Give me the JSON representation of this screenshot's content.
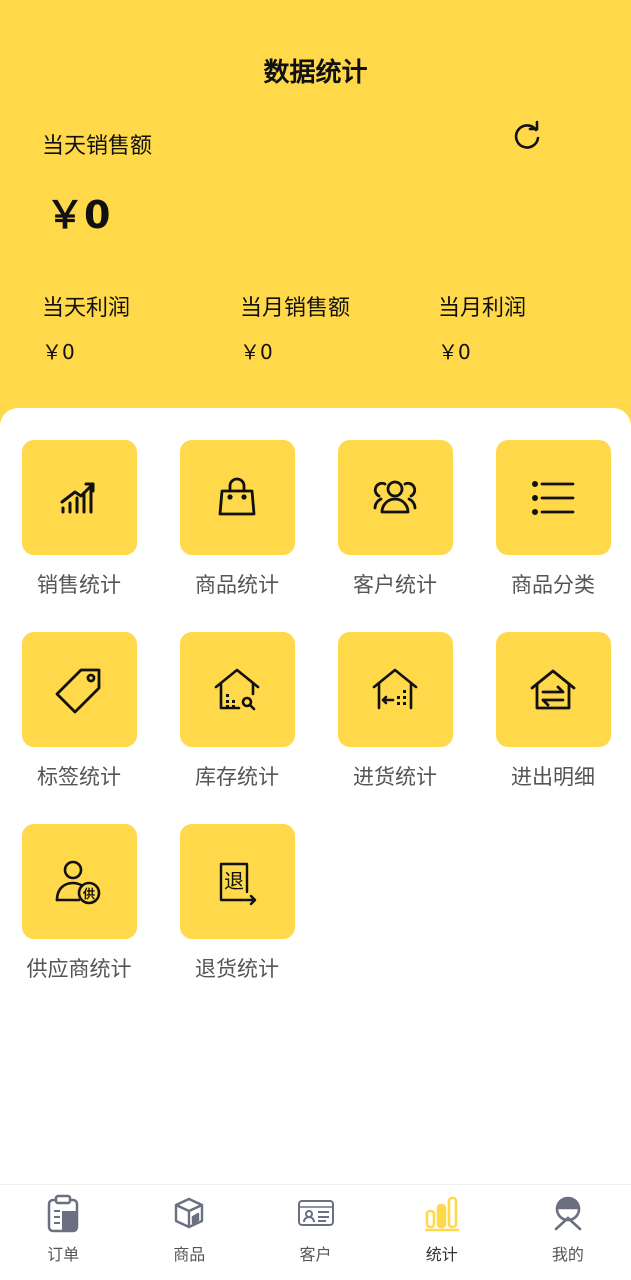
{
  "header": {
    "title": "数据统计",
    "today_sales_label": "当天销售额",
    "today_sales_value": "￥0",
    "stats": [
      {
        "label": "当天利润",
        "value": "￥0"
      },
      {
        "label": "当月销售额",
        "value": "￥0"
      },
      {
        "label": "当月利润",
        "value": "￥0"
      }
    ]
  },
  "grid": {
    "items": [
      {
        "label": "销售统计",
        "icon": "bar-chart-trend-icon"
      },
      {
        "label": "商品统计",
        "icon": "shopping-bag-icon"
      },
      {
        "label": "客户统计",
        "icon": "users-icon"
      },
      {
        "label": "商品分类",
        "icon": "list-icon"
      },
      {
        "label": "标签统计",
        "icon": "tag-icon"
      },
      {
        "label": "库存统计",
        "icon": "warehouse-search-icon"
      },
      {
        "label": "进货统计",
        "icon": "warehouse-inbound-icon"
      },
      {
        "label": "进出明细",
        "icon": "warehouse-exchange-icon"
      },
      {
        "label": "供应商统计",
        "icon": "supplier-icon"
      },
      {
        "label": "退货统计",
        "icon": "return-icon"
      }
    ],
    "supplier_badge": "供",
    "return_glyph": "退"
  },
  "tabbar": {
    "items": [
      {
        "label": "订单",
        "icon": "clipboard-icon"
      },
      {
        "label": "商品",
        "icon": "box-icon"
      },
      {
        "label": "客户",
        "icon": "contact-card-icon"
      },
      {
        "label": "统计",
        "icon": "stats-bars-icon",
        "active": true
      },
      {
        "label": "我的",
        "icon": "profile-icon"
      }
    ]
  },
  "colors": {
    "accent": "#FFD949",
    "text": "#111111",
    "muted": "#555555",
    "tab_icon": "#6B6F80"
  }
}
